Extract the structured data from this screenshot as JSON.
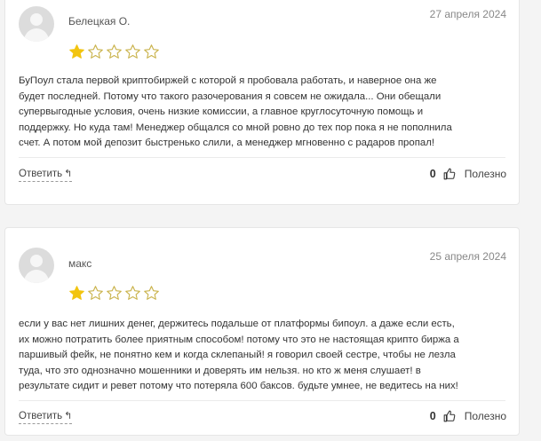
{
  "reviews": [
    {
      "author": "Белецкая О.",
      "date": "27 апреля 2024",
      "rating": 1,
      "rating_max": 5,
      "lines": [
        "БуПоул стала первой криптобиржей с которой я пробовала работать, и наверное она же",
        "будет последней. Потому что такого разочерования я совсем не ожидала... Они обещали",
        "супервыгодные условия, очень низкие комиссии, а главное круглосуточную помощь и",
        "поддержку. Но куда там! Менеджер общался со мной ровно до тех пор пока я не пополнила",
        "счет. А потом мой депозит быстренько слили, а менеджер мгновенно с радаров пропал!"
      ],
      "reply_label": "Ответить",
      "reply_icon": "↰",
      "likes": "0",
      "useful_label": "Полезно"
    },
    {
      "author": "макс",
      "date": "25 апреля 2024",
      "rating": 1,
      "rating_max": 5,
      "lines": [
        "если у вас нет лишних денег, держитесь подальше от платформы бипоул. а даже если есть,",
        "их можно потратить более приятным способом! потому что это не настоящая крипто биржа а",
        "паршивый фейк, не понятно кем и когда склепаный! я говорил своей сестре, чтобы не лезла",
        "туда, что это однозначно мошенники и доверять им нельзя. но кто ж меня слушает! в",
        "результате сидит и ревет потому что потеряла 600 баксов. будьте умнее, не ведитесь на них!"
      ],
      "reply_label": "Ответить",
      "reply_icon": "↰",
      "likes": "0",
      "useful_label": "Полезно"
    }
  ],
  "colors": {
    "star_filled": "#f2c40f",
    "star_empty": "#c9b24a"
  },
  "icons": {
    "reply": "reply-arrow-icon",
    "like": "thumbs-up-icon",
    "star": "star-icon"
  }
}
